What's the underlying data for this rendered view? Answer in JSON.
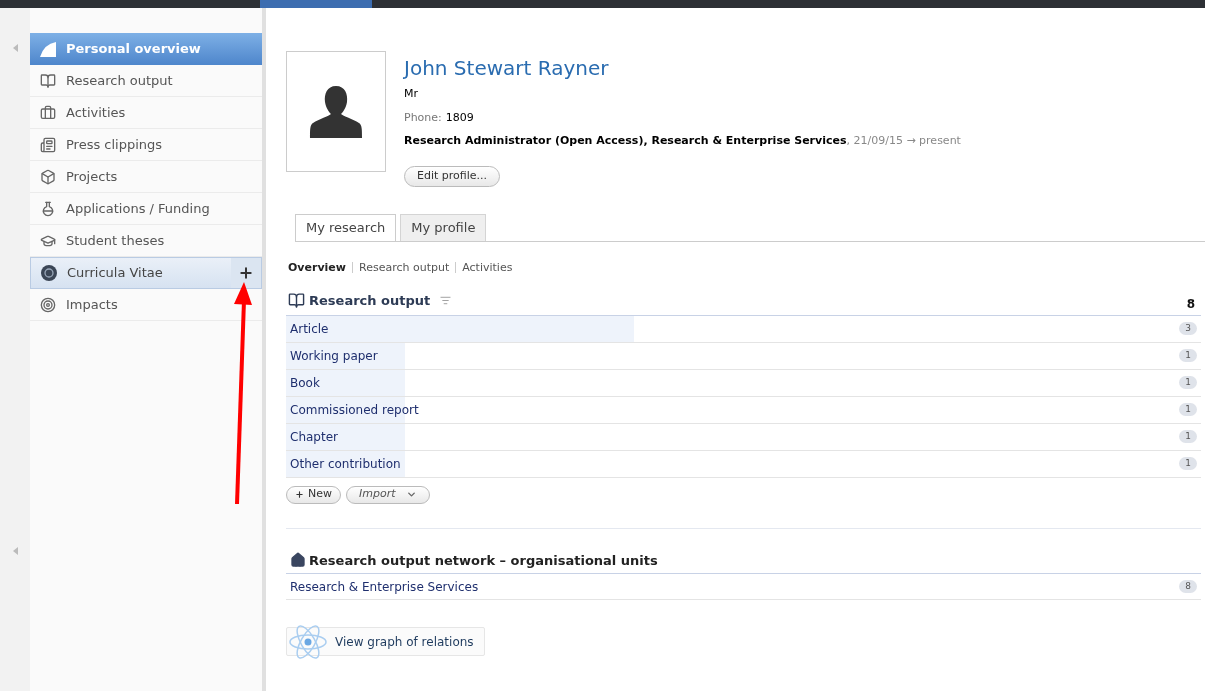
{
  "sidebar": {
    "items": [
      {
        "label": "Personal overview",
        "selected": true,
        "hovered": false
      },
      {
        "label": "Research output",
        "selected": false,
        "hovered": false
      },
      {
        "label": "Activities",
        "selected": false,
        "hovered": false
      },
      {
        "label": "Press clippings",
        "selected": false,
        "hovered": false
      },
      {
        "label": "Projects",
        "selected": false,
        "hovered": false
      },
      {
        "label": "Applications / Funding",
        "selected": false,
        "hovered": false
      },
      {
        "label": "Student theses",
        "selected": false,
        "hovered": false
      },
      {
        "label": "Curricula Vitae",
        "selected": false,
        "hovered": true
      },
      {
        "label": "Impacts",
        "selected": false,
        "hovered": false
      }
    ]
  },
  "profile": {
    "name": "John Stewart Rayner",
    "title": "Mr",
    "phone_label": "Phone:",
    "phone": "1809",
    "position": "Research Administrator (Open Access), Research & Enterprise Services",
    "dates": ", 21/09/15 → present",
    "edit_button": "Edit profile..."
  },
  "tabs": [
    {
      "label": "My research",
      "selected": true
    },
    {
      "label": "My profile",
      "selected": false
    }
  ],
  "subnav": [
    {
      "label": "Overview",
      "selected": true
    },
    {
      "label": "Research output",
      "selected": false
    },
    {
      "label": "Activities",
      "selected": false
    }
  ],
  "research_output": {
    "title": "Research output",
    "total": "8",
    "rows": [
      {
        "label": "Article",
        "count": "3",
        "level": 0.38
      },
      {
        "label": "Working paper",
        "count": "1",
        "level": 0.13
      },
      {
        "label": "Book",
        "count": "1",
        "level": 0.13
      },
      {
        "label": "Commissioned report",
        "count": "1",
        "level": 0.13
      },
      {
        "label": "Chapter",
        "count": "1",
        "level": 0.13
      },
      {
        "label": "Other contribution",
        "count": "1",
        "level": 0.13
      }
    ],
    "new_button": "New",
    "import_button": "Import"
  },
  "network": {
    "title": "Research output network – organisational units",
    "rows": [
      {
        "label": "Research & Enterprise Services",
        "count": "8"
      }
    ]
  },
  "graph_button": "View graph of relations"
}
